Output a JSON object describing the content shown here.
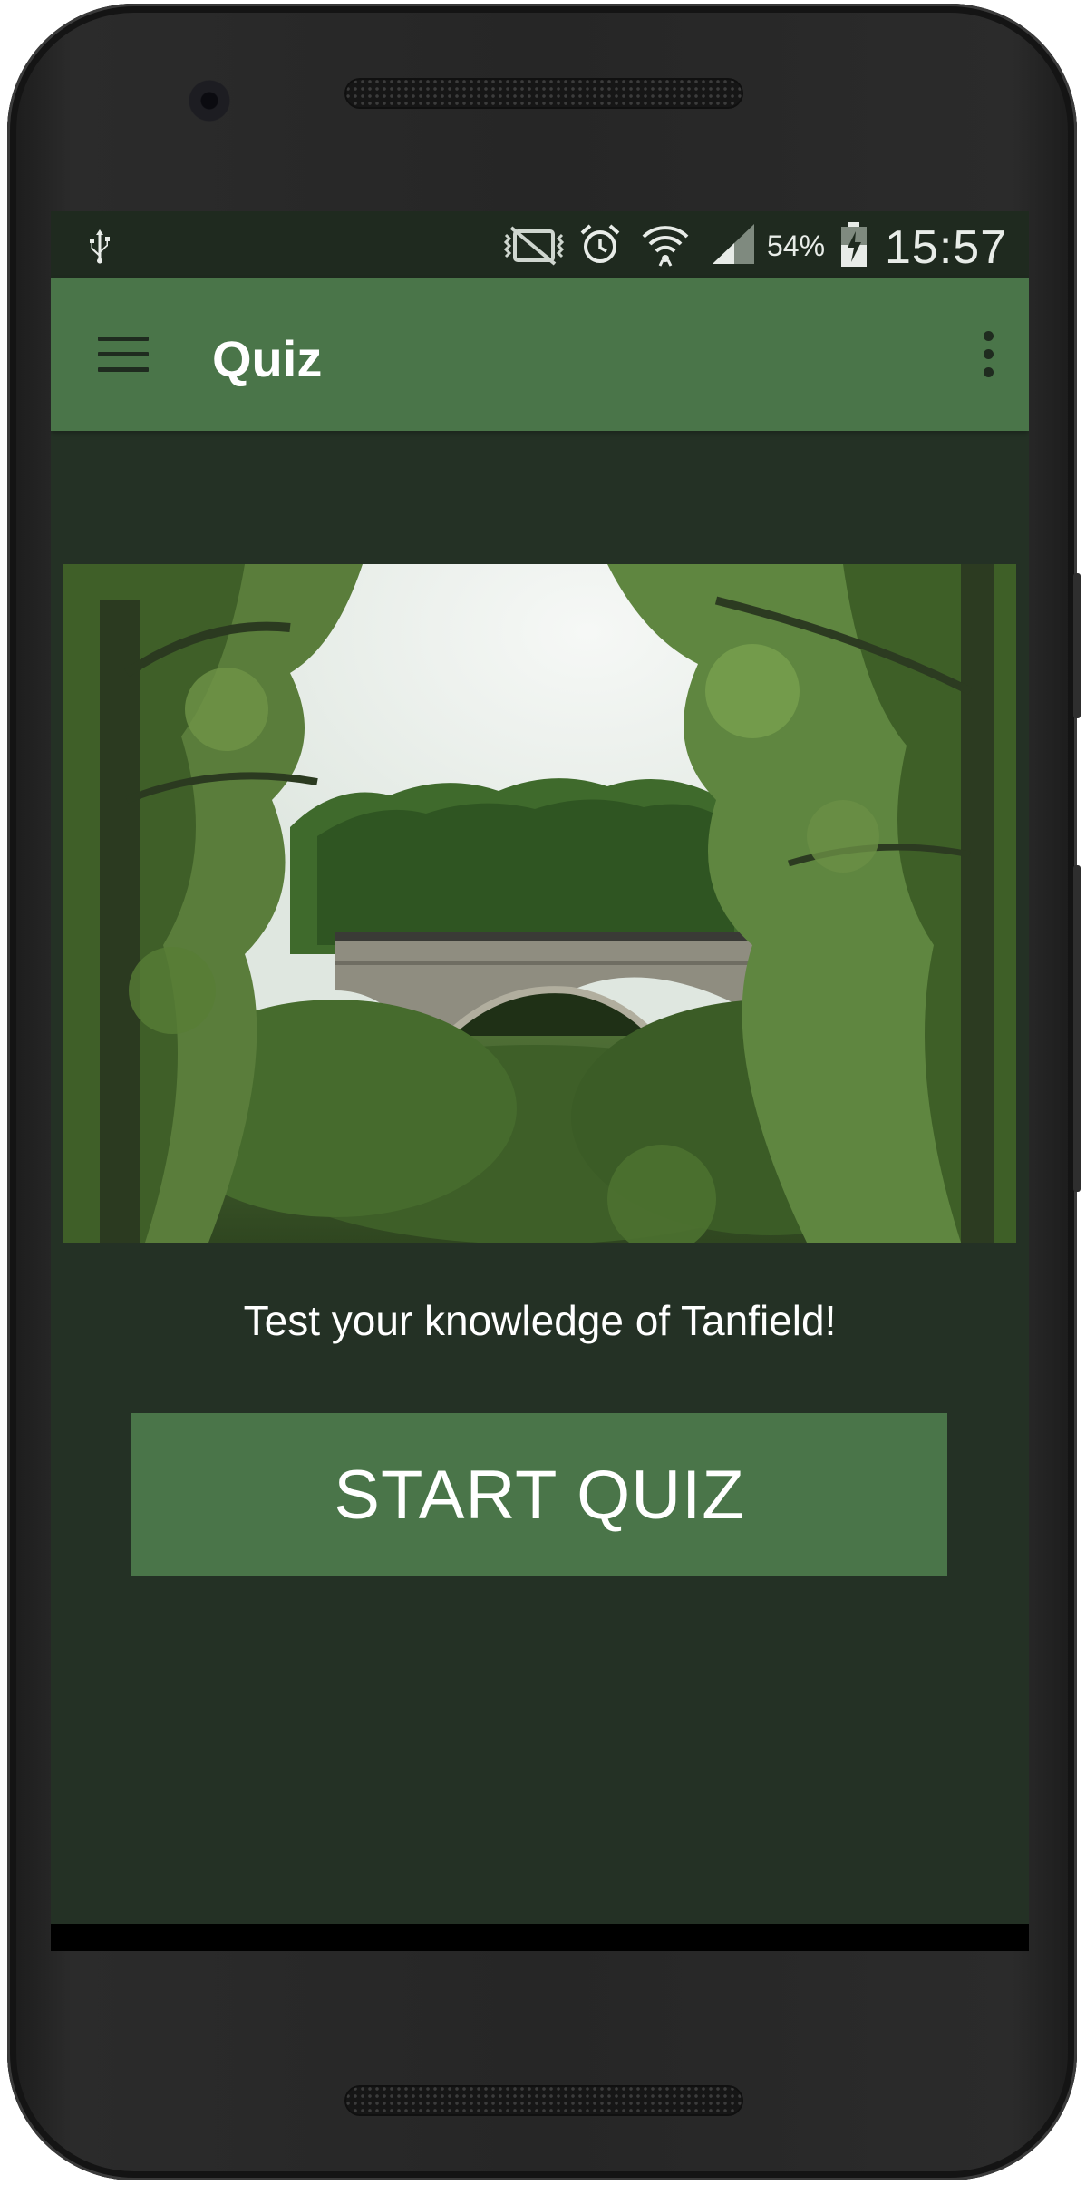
{
  "status_bar": {
    "icons": [
      "usb-icon",
      "vibrate-icon",
      "alarm-icon",
      "wifi-icon",
      "cell-signal-icon",
      "battery-charging-icon"
    ],
    "battery_percent": "54%",
    "time": "15:57"
  },
  "app_bar": {
    "title": "Quiz",
    "menu_icon": "hamburger-menu-icon",
    "overflow_icon": "more-vert-icon"
  },
  "hero_image": {
    "subject": "stone arch bridge among trees"
  },
  "main": {
    "tagline": "Test your knowledge of Tanfield!",
    "start_button_label": "START QUIZ"
  },
  "colors": {
    "app_bar": "#4a7549",
    "background": "#243125",
    "status_bar": "#1f2a1f",
    "button": "#4a7549",
    "text": "#ffffff"
  }
}
